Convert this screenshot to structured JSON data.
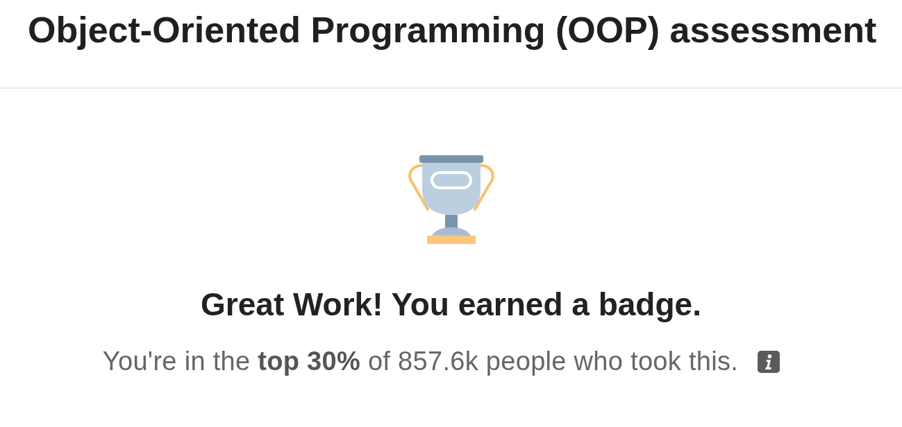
{
  "header": {
    "title": "Object-Oriented Programming (OOP) assessment"
  },
  "result": {
    "heading": "Great Work! You earned a badge.",
    "summary": "You're in the **top 30%** of 857.6k people who took this."
  }
}
